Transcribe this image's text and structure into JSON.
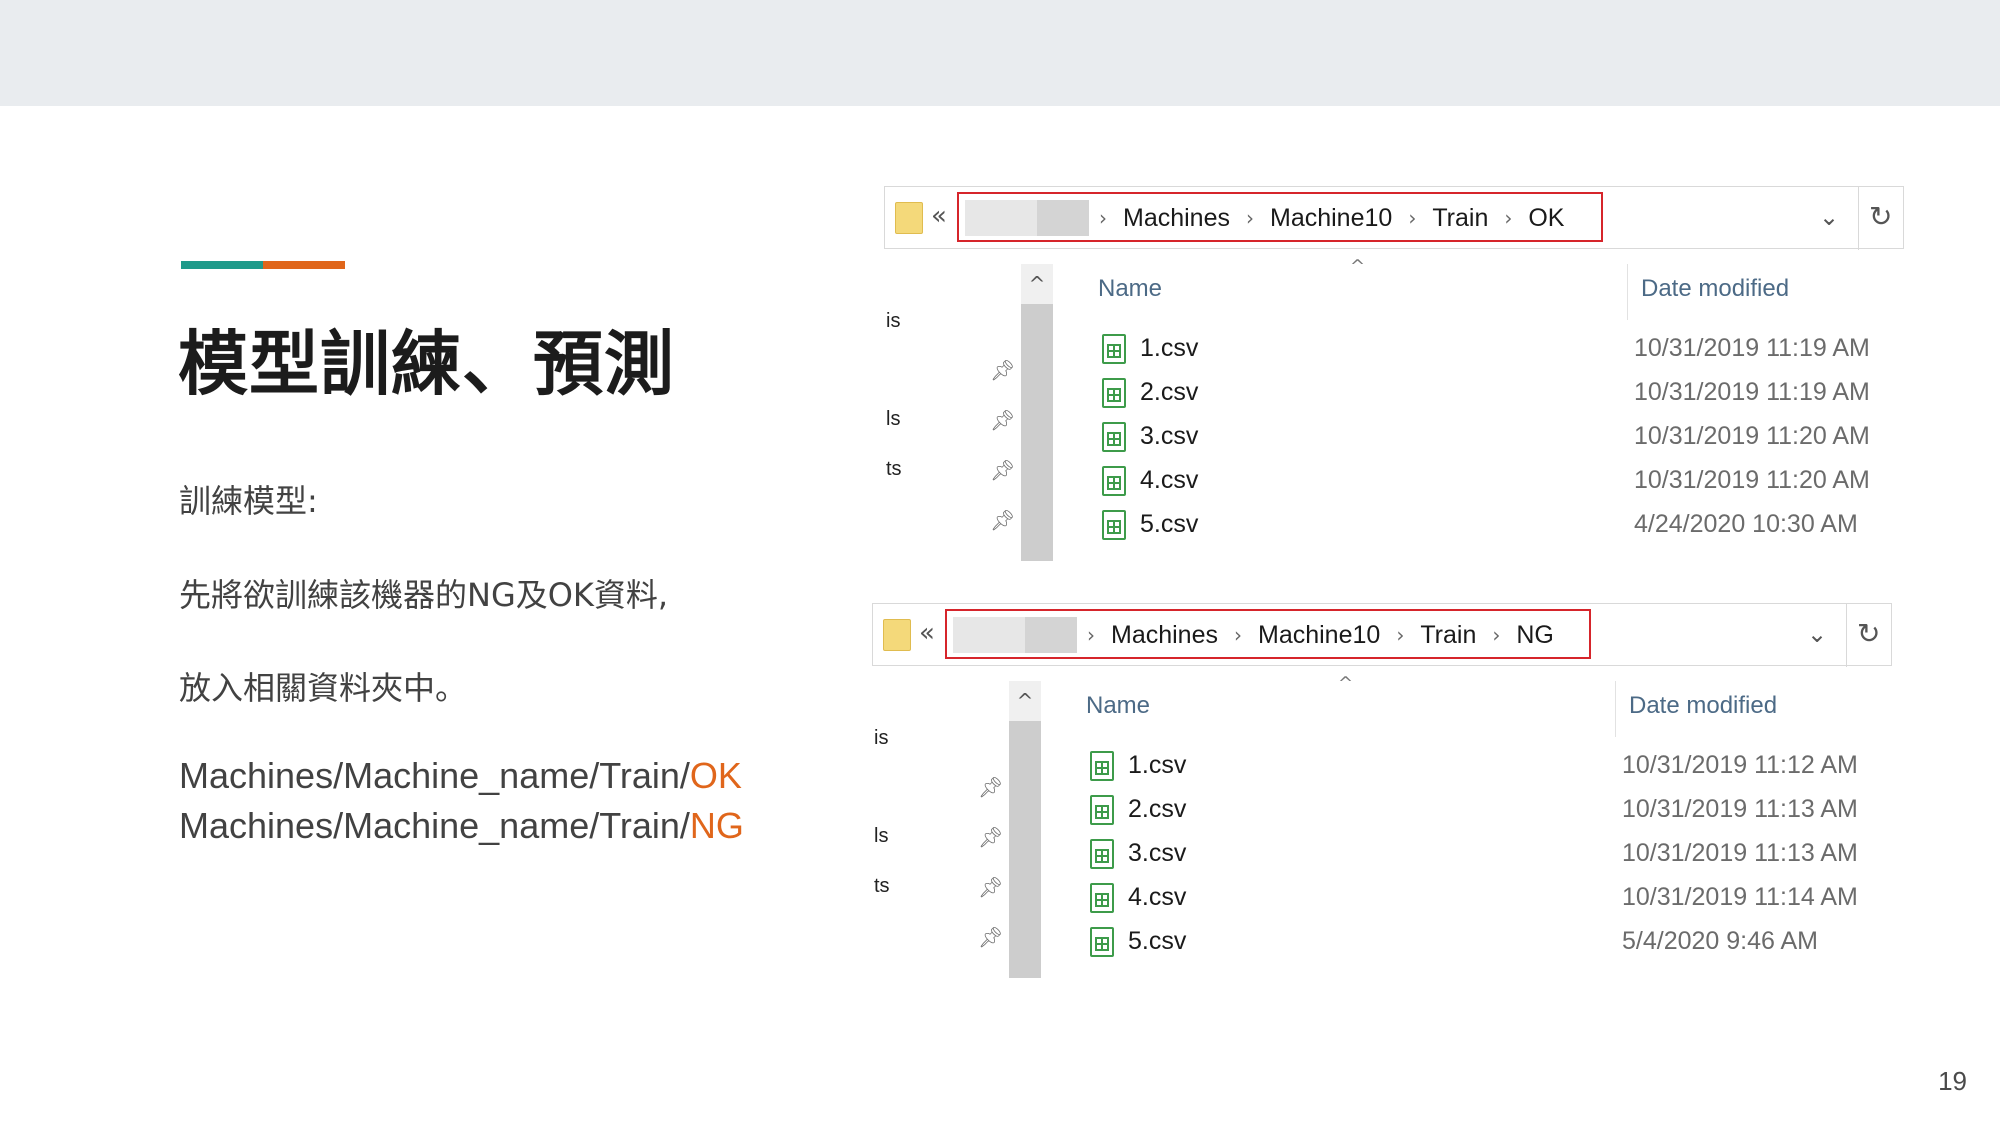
{
  "slide": {
    "title": "模型訓練、預測",
    "paragraph_1": "訓練模型:",
    "paragraph_2": "先將欲訓練該機器的NG及OK資料,",
    "paragraph_3": "放入相關資料夾中。",
    "path_ok_prefix": "Machines/Machine_name/Train/",
    "path_ok_suffix": "OK",
    "path_ng_prefix": "Machines/Machine_name/Train/",
    "path_ng_suffix": "NG",
    "page_number": "19",
    "colors": {
      "teal": "#1f9a8a",
      "orange": "#e0661b",
      "highlight_border": "#d6252b"
    }
  },
  "explorer_ok": {
    "nav_back_symbol": "«",
    "breadcrumbs": [
      "Machines",
      "Machine10",
      "Train",
      "OK"
    ],
    "crumb_separator": "›",
    "dropdown_symbol": "⌄",
    "refresh_symbol": "↻",
    "side_labels": [
      "is",
      "ls",
      "ts"
    ],
    "column_name": "Name",
    "column_date": "Date modified",
    "sort_symbol": "^",
    "scroll_up_symbol": "^",
    "files": [
      {
        "name": "1.csv",
        "date": "10/31/2019 11:19 AM"
      },
      {
        "name": "2.csv",
        "date": "10/31/2019 11:19 AM"
      },
      {
        "name": "3.csv",
        "date": "10/31/2019 11:20 AM"
      },
      {
        "name": "4.csv",
        "date": "10/31/2019 11:20 AM"
      },
      {
        "name": "5.csv",
        "date": "4/24/2020 10:30 AM"
      }
    ]
  },
  "explorer_ng": {
    "nav_back_symbol": "«",
    "breadcrumbs": [
      "Machines",
      "Machine10",
      "Train",
      "NG"
    ],
    "crumb_separator": "›",
    "dropdown_symbol": "⌄",
    "refresh_symbol": "↻",
    "side_labels": [
      "is",
      "ls",
      "ts"
    ],
    "column_name": "Name",
    "column_date": "Date modified",
    "sort_symbol": "^",
    "scroll_up_symbol": "^",
    "files": [
      {
        "name": "1.csv",
        "date": "10/31/2019 11:12 AM"
      },
      {
        "name": "2.csv",
        "date": "10/31/2019 11:13 AM"
      },
      {
        "name": "3.csv",
        "date": "10/31/2019 11:13 AM"
      },
      {
        "name": "4.csv",
        "date": "10/31/2019 11:14 AM"
      },
      {
        "name": "5.csv",
        "date": "5/4/2020 9:46 AM"
      }
    ],
    "pin_icon": "pin-icon",
    "file_icon": "csv-file-icon",
    "folder_icon": "folder-icon"
  }
}
